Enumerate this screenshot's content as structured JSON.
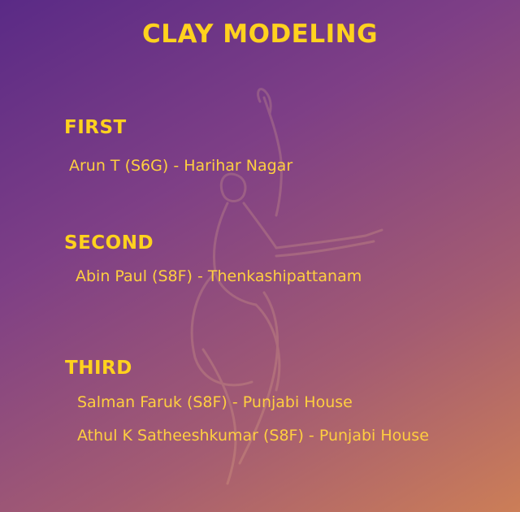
{
  "title": "CLAY MODELING",
  "sections": [
    {
      "heading": "FIRST",
      "entries": [
        "Arun T (S6G) - Harihar Nagar"
      ]
    },
    {
      "heading": "SECOND",
      "entries": [
        "Abin Paul (S8F) - Thenkashipattanam"
      ]
    },
    {
      "heading": "THIRD",
      "entries": [
        "Salman Faruk (S8F) - Punjabi House",
        "Athul K Satheeshkumar (S8F) - Punjabi House"
      ]
    }
  ],
  "colors": {
    "heading": "#ffd21e",
    "text": "#ffcf40",
    "background_start": "#5a2a86",
    "background_end": "#cc7e57"
  },
  "watermark_icon": "dancer-outline-icon"
}
